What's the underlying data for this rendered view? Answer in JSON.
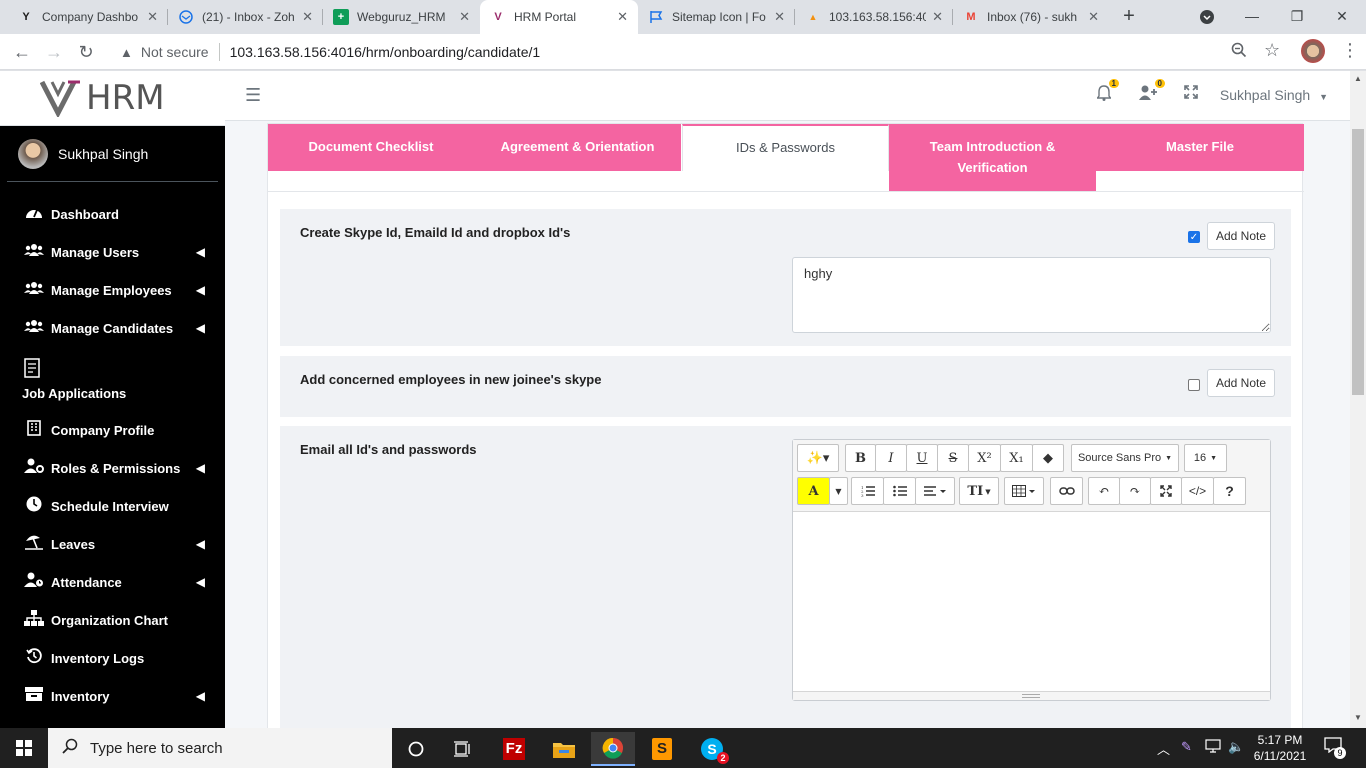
{
  "browser": {
    "tabs": [
      {
        "title": "Company Dashbo",
        "favicon": "Y",
        "fav_color": "#1a1a1a"
      },
      {
        "title": "(21) - Inbox - Zoh",
        "favicon": "mail",
        "fav_color": "#1a73e8"
      },
      {
        "title": "Webguruz_HRM",
        "favicon": "+",
        "fav_color": "#0f9d58"
      },
      {
        "title": "HRM Portal",
        "favicon": "V",
        "fav_color": "#9b2c6b"
      },
      {
        "title": "Sitemap Icon | Fo",
        "favicon": "flag",
        "fav_color": "#1a73e8"
      },
      {
        "title": "103.163.58.156:40",
        "favicon": "pma",
        "fav_color": "#f29111"
      },
      {
        "title": "Inbox (76) - sukh",
        "favicon": "M",
        "fav_color": "#ea4335"
      }
    ],
    "url_warning": "Not secure",
    "url": "103.163.58.156:4016/hrm/onboarding/candidate/1"
  },
  "sidebar": {
    "brand": "HRM",
    "user_name": "Sukhpal Singh",
    "items": [
      {
        "label": "Dashboard",
        "icon": "gauge-icon",
        "caret": false
      },
      {
        "label": "Manage Users",
        "icon": "users-icon",
        "caret": true
      },
      {
        "label": "Manage Employees",
        "icon": "users-icon",
        "caret": true
      },
      {
        "label": "Manage Candidates",
        "icon": "users-icon",
        "caret": true
      },
      {
        "label": "Job Applications",
        "icon": "document-icon",
        "caret": false
      },
      {
        "label": "Company Profile",
        "icon": "building-icon",
        "caret": false
      },
      {
        "label": "Roles & Permissions",
        "icon": "user-cog-icon",
        "caret": true
      },
      {
        "label": "Schedule Interview",
        "icon": "clock-icon",
        "caret": false
      },
      {
        "label": "Leaves",
        "icon": "umbrella-beach-icon",
        "caret": true
      },
      {
        "label": "Attendance",
        "icon": "user-clock-icon",
        "caret": true
      },
      {
        "label": "Organization Chart",
        "icon": "sitemap-icon",
        "caret": false
      },
      {
        "label": "Inventory Logs",
        "icon": "history-icon",
        "caret": false
      },
      {
        "label": "Inventory",
        "icon": "box-icon",
        "caret": true
      }
    ]
  },
  "topnav": {
    "notif_count": "1",
    "user_add_count": "0",
    "user_name": "Sukhpal Singh"
  },
  "page_tabs": [
    {
      "label": "Document Checklist",
      "active": false
    },
    {
      "label": "Agreement & Orientation",
      "active": false
    },
    {
      "label": "IDs & Passwords",
      "active": true
    },
    {
      "label": "Team Introduction & Verification",
      "active": false
    },
    {
      "label": "Master File",
      "active": false
    }
  ],
  "tasks": [
    {
      "title": "Create Skype Id, Emaild Id and dropbox Id's",
      "checked": true,
      "note_label": "Add Note",
      "note_value": "hghy"
    },
    {
      "title": "Add concerned employees in new joinee's skype",
      "checked": false,
      "note_label": "Add Note"
    },
    {
      "title": "Email all Id's and passwords",
      "editor": true
    }
  ],
  "editor": {
    "font_family": "Source Sans Pro",
    "font_size": "16",
    "buttons": [
      "magic-icon",
      "bold-icon",
      "italic-icon",
      "underline-icon",
      "strikethrough-icon",
      "superscript-icon",
      "subscript-icon",
      "eraser-icon",
      "font-color-icon",
      "ordered-list-icon",
      "unordered-list-icon",
      "align-icon",
      "text-height-icon",
      "table-icon",
      "link-icon",
      "undo-icon",
      "redo-icon",
      "fullscreen-icon",
      "code-view-icon",
      "help-icon"
    ]
  },
  "taskbar": {
    "search_placeholder": "Type here to search",
    "time": "5:17 PM",
    "date": "6/11/2021",
    "notification_count": "9",
    "skype_badge": "2"
  }
}
